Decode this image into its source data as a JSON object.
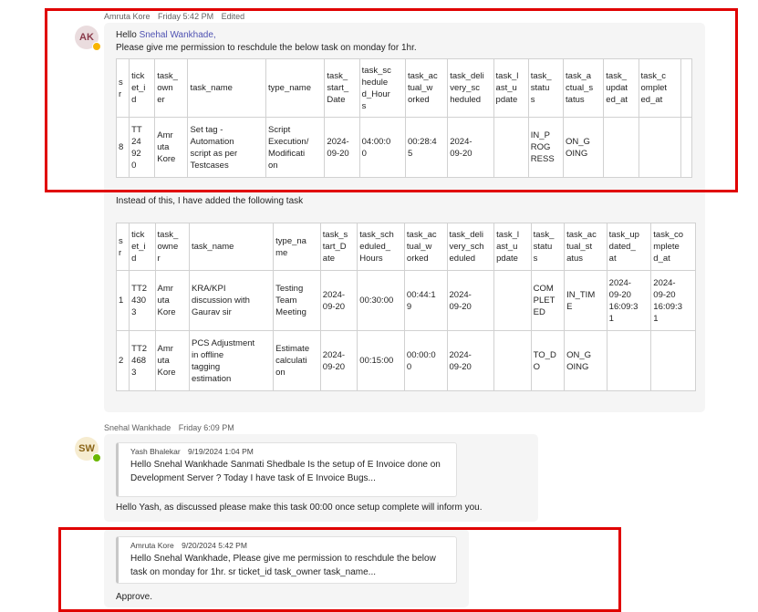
{
  "messages": [
    {
      "sender": "Amruta Kore",
      "time": "Friday 5:42 PM",
      "edited": "Edited",
      "initials": "AK",
      "greeting": "Hello",
      "mention": "Snehal Wankhade,",
      "line2": "Please give me permission to reschdule the below task on monday for 1hr.",
      "table1": {
        "headers": [
          "s\nr",
          "tick\net_i\nd",
          "task_\nown\ner",
          "task_name",
          "type_name",
          "task_\nstart_\nDate",
          "task_sc\nhedule\nd_Hour\ns",
          "task_ac\ntual_w\norked",
          "task_deli\nvery_sc\nheduled",
          "task_l\nast_u\npdate",
          "task_\nstatu\ns",
          "task_a\nctual_s\ntatus",
          "task_\nupdat\ned_at",
          "task_c\nomplet\ned_at",
          ""
        ],
        "rows": [
          [
            "8",
            "TT\n24\n92\n0",
            "Amr\nuta\nKore",
            "Set tag -\nAutomation\nscript as per\nTestcases",
            "Script\nExecution/\nModificati\non",
            "2024-\n09-20",
            "04:00:0\n0",
            "00:28:4\n5",
            "2024-\n09-20",
            "",
            "IN_P\nROG\nRESS",
            "ON_G\nOING",
            "",
            "",
            ""
          ]
        ]
      },
      "line3": "Instead of this, I have added the following task",
      "table2": {
        "headers": [
          "s\nr",
          "tick\net_i\nd",
          "task_\nowne\nr",
          "task_name",
          "type_na\nme",
          "task_s\ntart_D\nate",
          "task_sch\neduled_\nHours",
          "task_ac\ntual_w\norked",
          "task_deli\nvery_sch\neduled",
          "task_l\nast_u\npdate",
          "task_\nstatu\ns",
          "task_ac\ntual_st\natus",
          "task_up\ndated_\nat",
          "task_co\nmplete\nd_at"
        ],
        "rows": [
          [
            "1",
            "TT2\n430\n3",
            "Amr\nuta\nKore",
            "KRA/KPI\ndiscussion with\nGaurav sir",
            "Testing\nTeam\nMeeting",
            "2024-\n09-20",
            "00:30:00",
            "00:44:1\n9",
            "2024-\n09-20",
            "",
            "COM\nPLET\nED",
            "IN_TIM\nE",
            "2024-\n09-20\n16:09:3\n1",
            "2024-\n09-20\n16:09:3\n1"
          ],
          [
            "2",
            "TT2\n468\n3",
            "Amr\nuta\nKore",
            "PCS Adjustment\nin offline\ntagging\nestimation",
            "Estimate\ncalculati\non",
            "2024-\n09-20",
            "00:15:00",
            "00:00:0\n0",
            "2024-\n09-20",
            "",
            "TO_D\nO",
            "ON_G\nOING",
            "",
            ""
          ]
        ]
      }
    },
    {
      "sender": "Snehal Wankhade",
      "time": "Friday 6:09 PM",
      "initials": "SW",
      "quote": {
        "author": "Yash Bhalekar",
        "time": "9/19/2024 1:04 PM",
        "text": "Hello Snehal Wankhade Sanmati Shedbale Is the setup of E Invoice done on Development Server ? Today I have task of E Invoice Bugs..."
      },
      "text": "Hello Yash, as discussed please make this  task 00:00 once setup complete will inform you.",
      "quote2": {
        "author": "Amruta Kore",
        "time": "9/20/2024 5:42 PM",
        "text": "Hello Snehal Wankhade, Please give me permission to reschdule the below task on monday for 1hr. sr ticket_id task_owner task_name..."
      },
      "text2": "Approve."
    }
  ]
}
